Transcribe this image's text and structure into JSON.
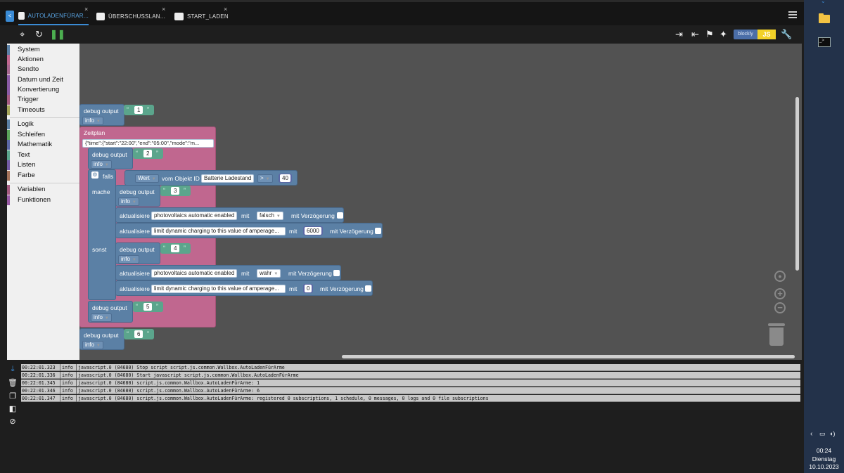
{
  "tabs": [
    {
      "label": "AUTOLADENFÜRAR...",
      "active": true
    },
    {
      "label": "ÜBERSCHUSSLAN...",
      "active": false
    },
    {
      "label": "START_LADEN",
      "active": false
    }
  ],
  "tab_close_glyph": "×",
  "toolbar": {
    "blockly_label": "blockly",
    "js_label": "JS"
  },
  "categories": [
    {
      "label": "System",
      "color": "#5b80a5"
    },
    {
      "label": "Aktionen",
      "color": "#c0678f"
    },
    {
      "label": "Sendto",
      "color": "#a5678f"
    },
    {
      "label": "Datum und Zeit",
      "color": "#8a5ba5"
    },
    {
      "label": "Konvertierung",
      "color": "#8a5ba5"
    },
    {
      "label": "Trigger",
      "color": "#a55b80"
    },
    {
      "label": "Timeouts",
      "color": "#a5a55b"
    },
    {
      "label": "Logik",
      "color": "#5b80a5"
    },
    {
      "label": "Schleifen",
      "color": "#5ba55b"
    },
    {
      "label": "Mathematik",
      "color": "#5b67a5"
    },
    {
      "label": "Text",
      "color": "#5ba58c"
    },
    {
      "label": "Listen",
      "color": "#745ba5"
    },
    {
      "label": "Farbe",
      "color": "#a5745b"
    },
    {
      "label": "Variablen",
      "color": "#a55b80"
    },
    {
      "label": "Funktionen",
      "color": "#995ba5"
    }
  ],
  "blocks": {
    "debug_label": "debug output",
    "level_info": "info",
    "d1": "1",
    "d2": "2",
    "d3": "3",
    "d4": "4",
    "d5": "5",
    "d6": "6",
    "zeitplan_label": "Zeitplan",
    "zeitplan_value": "{\"time\":{\"start\":\"22:00\",\"end\":\"05:00\",\"mode\":\"m...",
    "falls_label": "falls",
    "mache_label": "mache",
    "sonst_label": "sonst",
    "wert_label": "Wert",
    "vom_objekt_label": "vom Objekt ID",
    "objekt_name": "Batterie Ladestand",
    "operator": ">",
    "compare_value": "40",
    "aktualisiere_label": "aktualisiere",
    "mit_label": "mit",
    "mit_verzoegerung_label": "mit Verzögerung",
    "pv_auto_name": "photovoltaics automatic enabled",
    "amp_name": "limit dynamic charging to this value of amperage...",
    "val_falsch": "falsch",
    "val_6000": "6000",
    "val_wahr": "wahr",
    "val_0": "0"
  },
  "log": [
    {
      "time": "00:22:01.323",
      "level": "info",
      "msg": "javascript.0 (84680) Stop script script.js.common.Wallbox.AutoLadenFürArme"
    },
    {
      "time": "00:22:01.336",
      "level": "info",
      "msg": "javascript.0 (84680) Start javascript script.js.common.Wallbox.AutoLadenFürArme"
    },
    {
      "time": "00:22:01.345",
      "level": "info",
      "msg": "javascript.0 (84680) script.js.common.Wallbox.AutoLadenFürArme: 1"
    },
    {
      "time": "00:22:01.346",
      "level": "info",
      "msg": "javascript.0 (84680) script.js.common.Wallbox.AutoLadenFürArme: 6"
    },
    {
      "time": "00:22:01.347",
      "level": "info",
      "msg": "javascript.0 (84680) script.js.common.Wallbox.AutoLadenFürArme: registered 0 subscriptions, 1 schedule, 0 messages, 0 logs and 0 file subscriptions"
    }
  ],
  "clock": {
    "time": "00:24",
    "day": "Dienstag",
    "date": "10.10.2023"
  }
}
